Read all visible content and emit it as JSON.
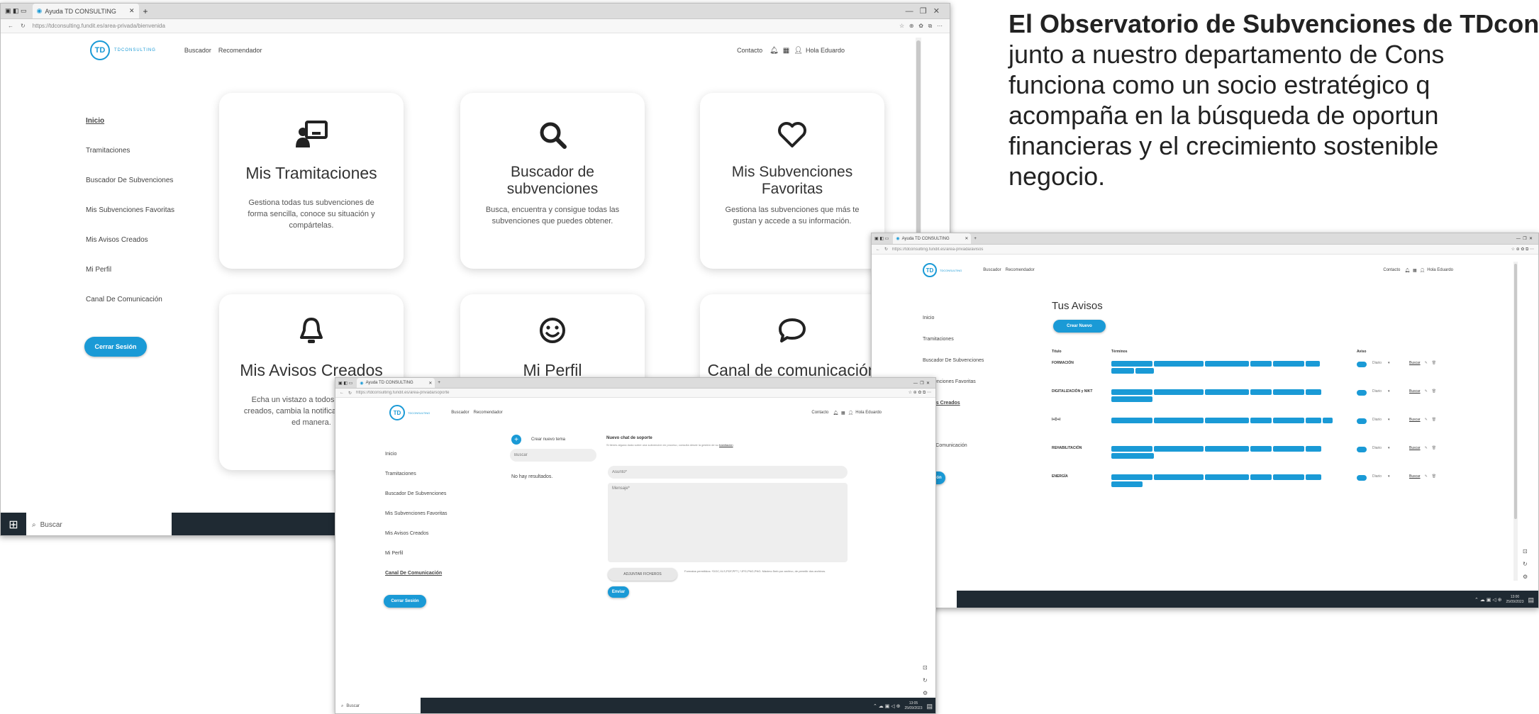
{
  "paragraph": {
    "bold_lead": "El Observatorio de Subvenciones de TDcon",
    "line2": "junto a nuestro departamento de Cons",
    "line3": "funciona como un socio estratégico q",
    "line4": "acompaña en la búsqueda de oportun",
    "line5": "financieras y el crecimiento sostenible",
    "line6": "negocio."
  },
  "shot1": {
    "tab_title": "Ayuda TD CONSULTING",
    "url": "https://tdconsulting.fundit.es/area-privada/bienvenida",
    "brand": "TDCONSULTING",
    "nav_links": [
      "Buscador",
      "Recomendador"
    ],
    "header_right": {
      "contact": "Contacto",
      "greeting": "Hola Eduardo"
    },
    "sidebar": [
      "Inicio",
      "Tramitaciones",
      "Buscador De Subvenciones",
      "Mis Subvenciones Favoritas",
      "Mis Avisos Creados",
      "Mi Perfil",
      "Canal De Comunicación"
    ],
    "logout": "Cerrar Sesión",
    "cards": [
      {
        "title": "Mis Tramitaciones",
        "desc": "Gestiona todas tus subvenciones de forma sencilla, conoce su situación y compártelas.",
        "icon": "person-board-icon"
      },
      {
        "title": "Buscador de subvenciones",
        "desc": "Busca, encuentra y consigue todas las subvenciones que puedes obtener.",
        "icon": "search-icon"
      },
      {
        "title": "Mis Subvenciones Favoritas",
        "desc": "Gestiona las subvenciones que más te gustan y accede a su información.",
        "icon": "heart-icon"
      },
      {
        "title": "Mis Avisos Creados",
        "desc": "Echa un vistazo a todos tus avisos creados, cambia la notificación, podrás ed manera.",
        "icon": "bell-icon"
      },
      {
        "title": "Mi Perfil",
        "desc": "",
        "icon": "smiley-icon"
      },
      {
        "title": "Canal de comunicación",
        "desc": "",
        "icon": "chat-bubble-icon"
      }
    ],
    "taskbar_search": "Buscar"
  },
  "shot2": {
    "tab_title": "Ayuda TD CONSULTING",
    "url": "https://tdconsulting.fundit.es/area-privada/avisos",
    "brand": "TDCONSULTING",
    "nav_links": [
      "Buscador",
      "Recomendador"
    ],
    "header_right": {
      "contact": "Contacto",
      "greeting": "Hola Eduardo"
    },
    "heading": "Tus Avisos",
    "create_btn": "Crear Nuevo",
    "sidebar": [
      "Inicio",
      "Tramitaciones",
      "Buscador De Subvenciones",
      "Subvenciones Favoritas",
      "Avisos Creados",
      "erfil",
      "al De Comunicación"
    ],
    "logout": "rar Sesión",
    "columns": [
      "Título",
      "Términos",
      "Aviso"
    ],
    "rows": [
      {
        "title": "FORMACIÓN",
        "freq": "Diario",
        "action": "Buscar"
      },
      {
        "title": "DIGITALIZACIÓN y NIKT",
        "freq": "Diario",
        "action": "Buscar"
      },
      {
        "title": "I+D+I",
        "freq": "Diario",
        "action": "Buscar"
      },
      {
        "title": "REHABILITACIÓN",
        "freq": "Diario",
        "action": "Buscar"
      },
      {
        "title": "ENERGÍA",
        "freq": "Diario",
        "action": "Buscar"
      }
    ],
    "clock": {
      "time": "13:00",
      "date": "25/09/2023"
    }
  },
  "shot3": {
    "tab_title": "Ayuda TD CONSULTING",
    "url": "https://tdconsulting.fundit.es/area-privada/soporte",
    "brand": "TDCONSULTING",
    "nav_links": [
      "Buscador",
      "Recomendador"
    ],
    "header_right": {
      "contact": "Contacto",
      "greeting": "Hola Eduardo"
    },
    "sidebar": [
      "Inicio",
      "Tramitaciones",
      "Buscador De Subvenciones",
      "Mis Subvenciones Favoritas",
      "Mis Avisos Creados",
      "Mi Perfil",
      "Canal De Comunicación"
    ],
    "logout": "Cerrar Sesión",
    "new_chat_label": "Crear nuevo tema",
    "search_placeholder": "Buscar",
    "no_results": "No hay resultados.",
    "chat_title": "Nuevo chat de soporte",
    "chat_hint": "Si tienes alguna duda sobre una subvención en proceso, consulta desde la gestión de su",
    "chat_hint_link": "tramitación",
    "subject_placeholder": "Asunto*",
    "message_placeholder": "Mensaje*",
    "attach_btn": "ADJUNTAR FICHEROS",
    "formats_note": "Formatos permitidos: *DOC,XLS,PDF,PPT | *JPG,PNG,PNG. Máximo 5mb por archivo, de permitir dos archivos.",
    "send_btn": "Enviar",
    "taskbar_search": "Buscar",
    "clock": {
      "time": "13:05",
      "date": "25/09/2023"
    }
  },
  "colors": {
    "accent": "#1a9ad6",
    "taskbar": "#1f2a33",
    "chip": "#1a9ad6"
  }
}
